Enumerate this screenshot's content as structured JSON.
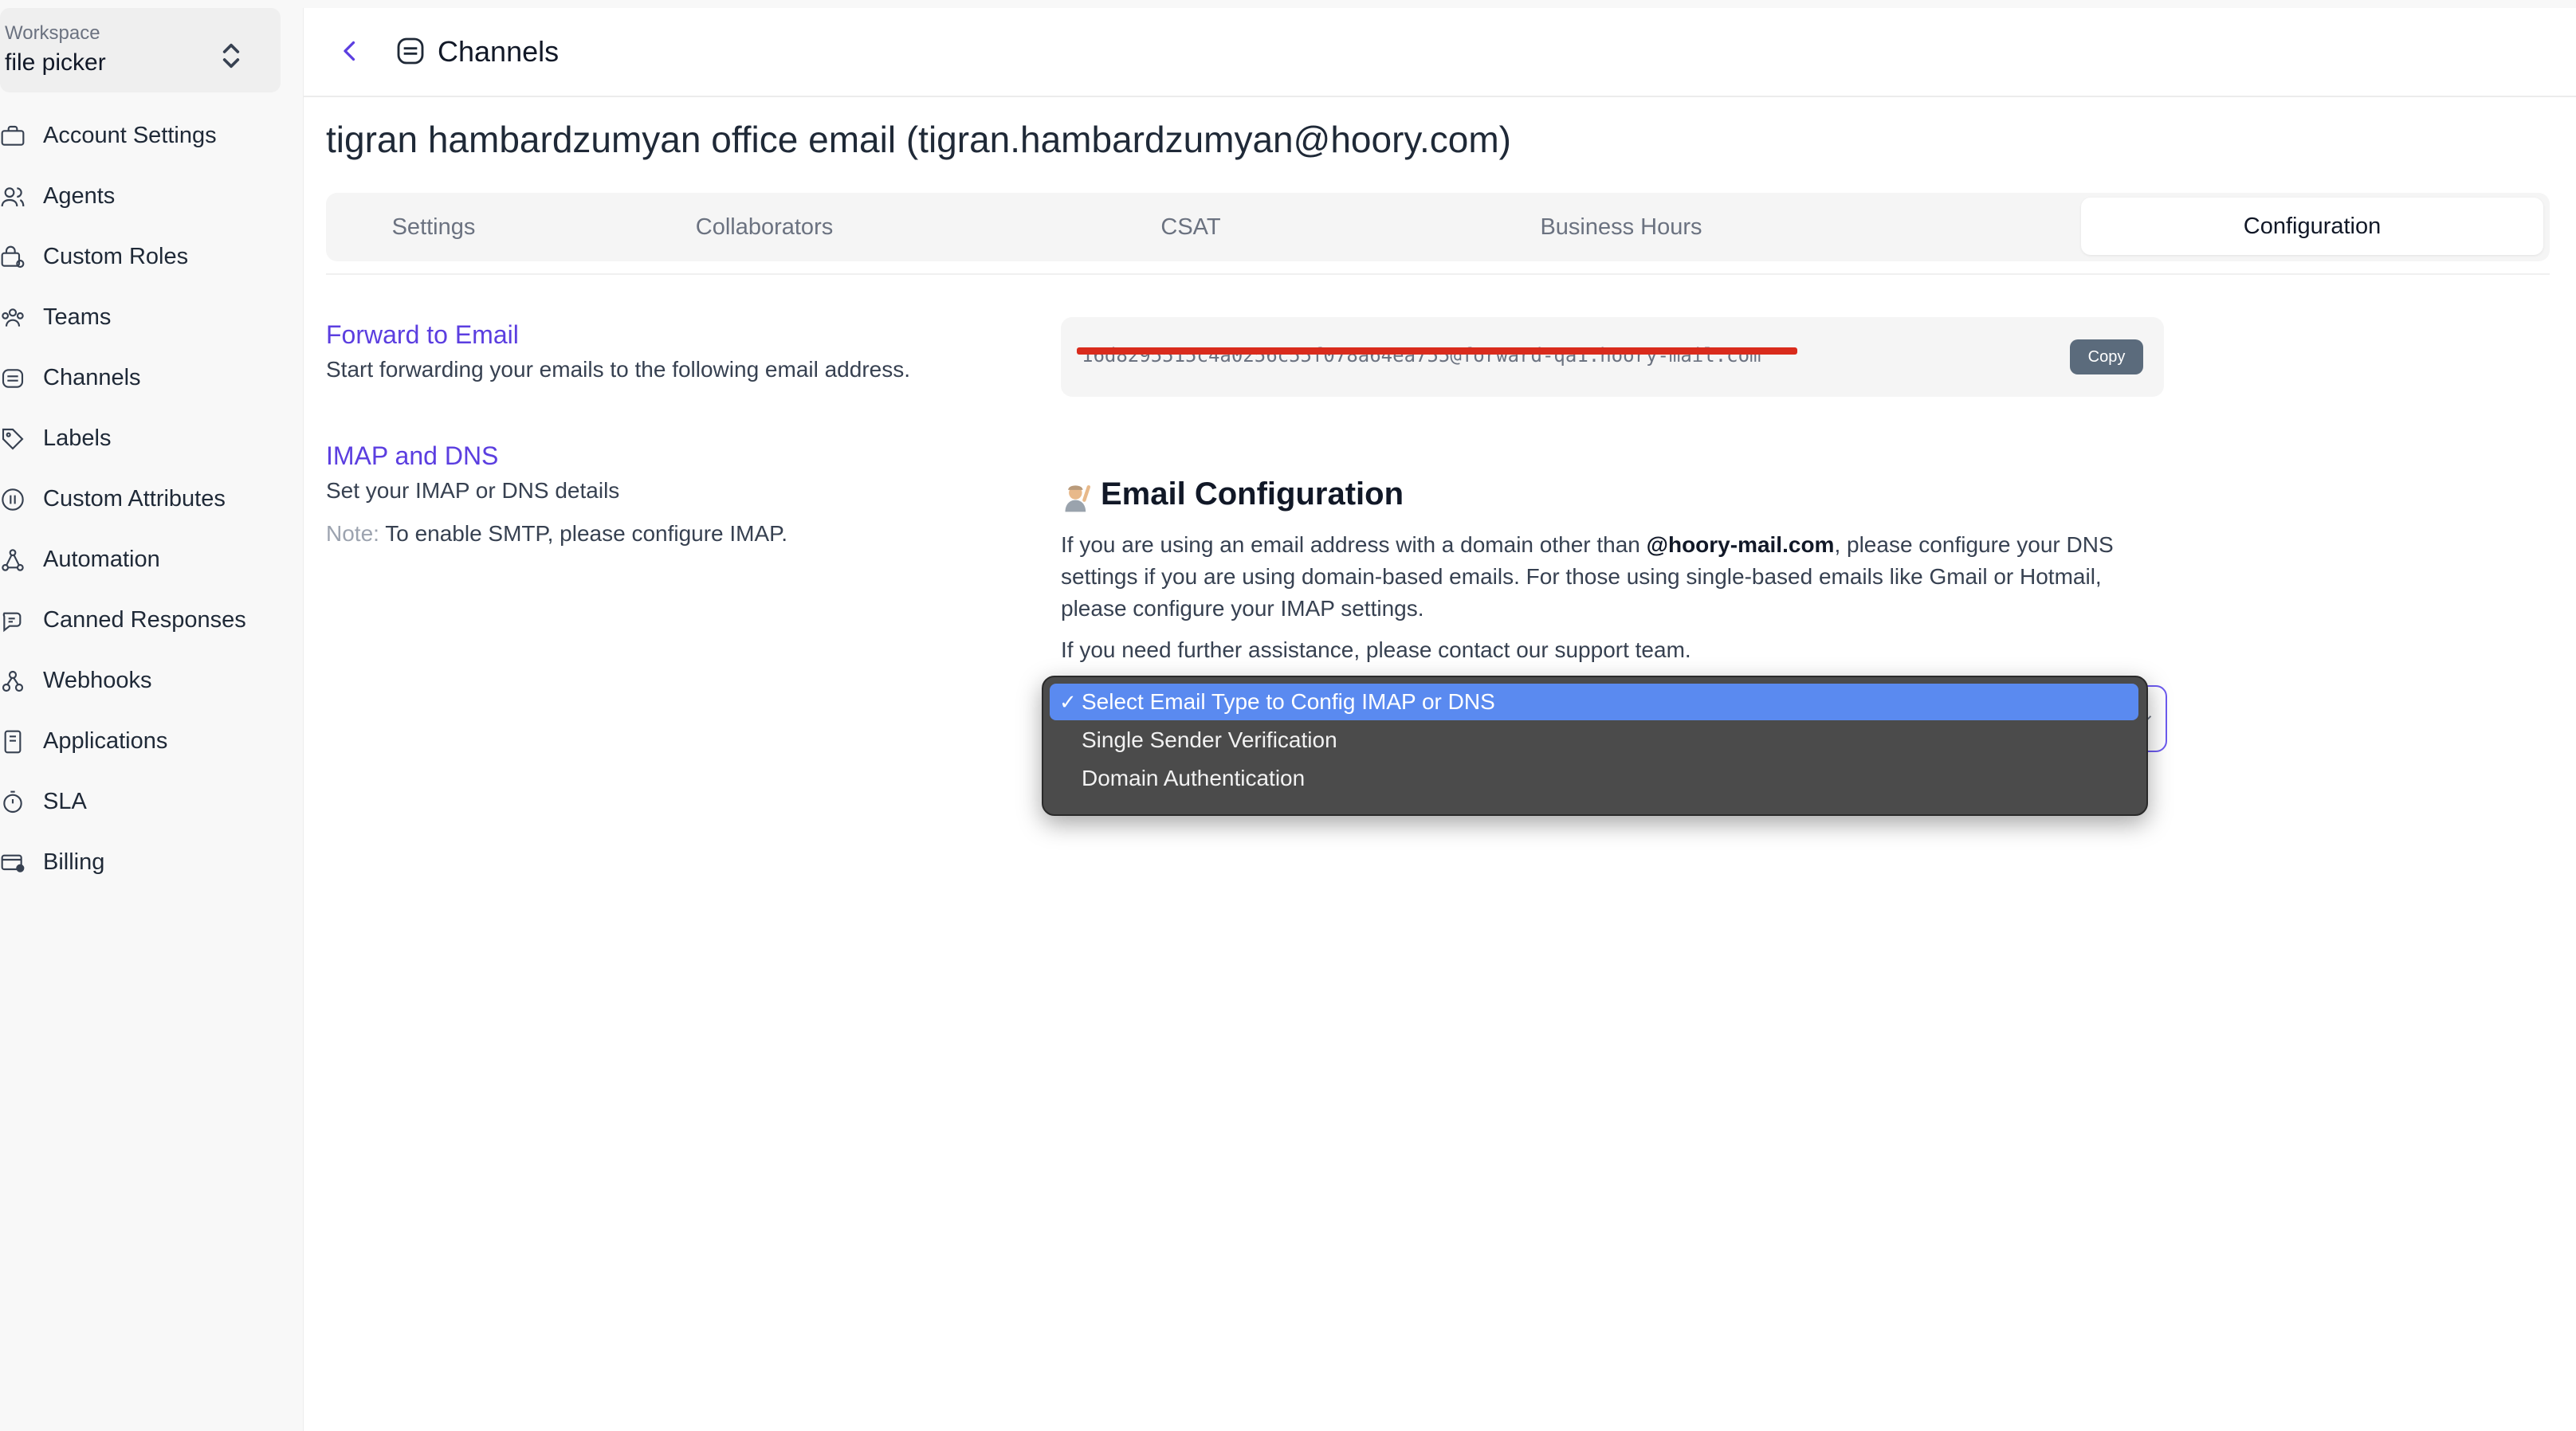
{
  "sidebar": {
    "workspace_caption": "Workspace",
    "workspace_name": "file picker",
    "items": [
      {
        "label": "Account Settings",
        "icon": "briefcase-icon"
      },
      {
        "label": "Agents",
        "icon": "users-icon"
      },
      {
        "label": "Custom Roles",
        "icon": "role-icon"
      },
      {
        "label": "Teams",
        "icon": "team-icon"
      },
      {
        "label": "Channels",
        "icon": "inbox-icon"
      },
      {
        "label": "Labels",
        "icon": "tag-icon"
      },
      {
        "label": "Custom Attributes",
        "icon": "attribute-icon"
      },
      {
        "label": "Automation",
        "icon": "automation-icon"
      },
      {
        "label": "Canned Responses",
        "icon": "chat-icon"
      },
      {
        "label": "Webhooks",
        "icon": "webhook-icon"
      },
      {
        "label": "Applications",
        "icon": "applications-icon"
      },
      {
        "label": "SLA",
        "icon": "timer-icon"
      },
      {
        "label": "Billing",
        "icon": "billing-icon"
      }
    ]
  },
  "header": {
    "title": "Channels"
  },
  "inbox": {
    "title": "tigran hambardzumyan office email (tigran.hambardzumyan@hoory.com)"
  },
  "tabs": [
    {
      "label": "Settings"
    },
    {
      "label": "Collaborators"
    },
    {
      "label": "CSAT"
    },
    {
      "label": "Business Hours"
    },
    {
      "label": "Configuration",
      "active": true
    }
  ],
  "forward": {
    "title": "Forward to Email",
    "description": "Start forwarding your emails to the following email address.",
    "address": "16d8295515c4a0256c55f078a64ea755@forward-qa1.hoory-mail.com",
    "copy_label": "Copy"
  },
  "imap": {
    "title": "IMAP and DNS",
    "description": "Set your IMAP or DNS details",
    "note_label": "Note:",
    "note_text": " To enable SMTP, please configure IMAP."
  },
  "email_config": {
    "title": "Email Configuration",
    "para_before": "If you are using an email address with a domain other than ",
    "domain": "@hoory-mail.com",
    "para_after": ", please configure your DNS settings if you are using domain-based emails. For those using single-based emails like Gmail or Hotmail, please configure your IMAP settings.",
    "assistance": "If you need further assistance, please contact our support team."
  },
  "dropdown": {
    "options": [
      {
        "label": "Select Email Type to Config IMAP or DNS",
        "selected": true
      },
      {
        "label": "Single Sender Verification",
        "selected": false
      },
      {
        "label": "Domain Authentication",
        "selected": false
      }
    ],
    "check_mark": "✓"
  },
  "colors": {
    "accent": "#5b3ee0",
    "selected_option": "#5a8af0",
    "redaction": "#d92b1c"
  }
}
